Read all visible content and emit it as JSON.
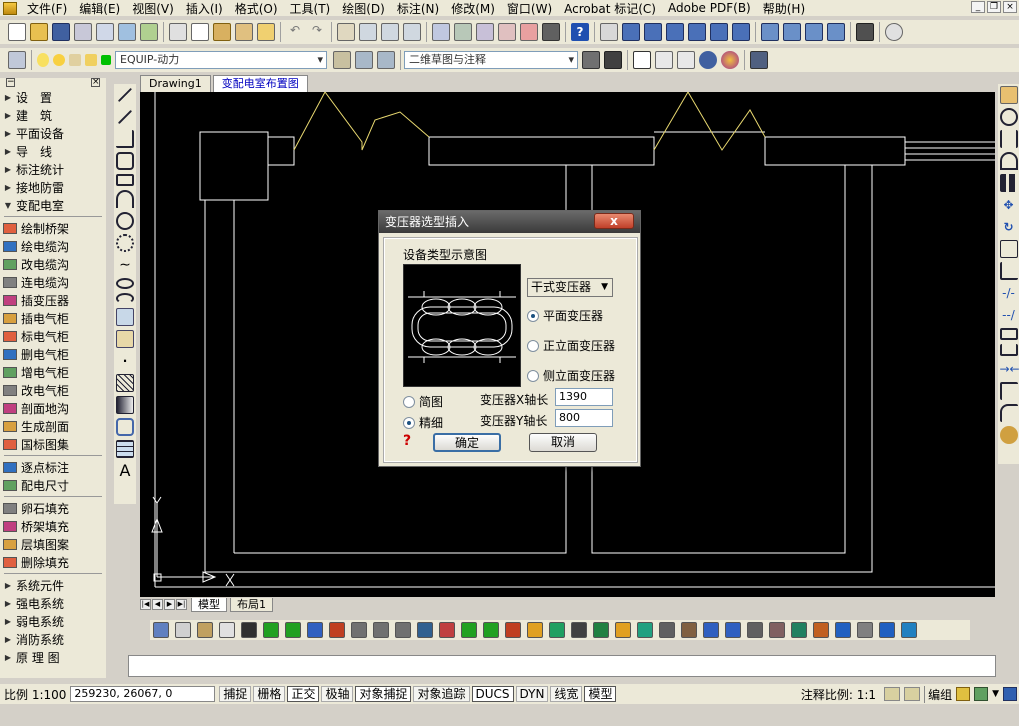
{
  "menu": {
    "items": [
      "文件(F)",
      "编辑(E)",
      "视图(V)",
      "插入(I)",
      "格式(O)",
      "工具(T)",
      "绘图(D)",
      "标注(N)",
      "修改(M)",
      "窗口(W)",
      "Acrobat 标记(C)",
      "Adobe PDF(B)",
      "帮助(H)"
    ]
  },
  "toolbar": {
    "layer_combo": "EQUIP-动力",
    "workspace_combo": "二维草图与注释"
  },
  "sidebar": {
    "items": [
      {
        "label": "设　置",
        "type": "arrow"
      },
      {
        "label": "建　筑",
        "type": "arrow"
      },
      {
        "label": "平面设备",
        "type": "arrow"
      },
      {
        "label": "导　线",
        "type": "arrow"
      },
      {
        "label": "标注统计",
        "type": "arrow"
      },
      {
        "label": "接地防雷",
        "type": "arrow"
      },
      {
        "label": "变配电室",
        "type": "open"
      },
      {
        "label": "绘制桥架",
        "type": "icon"
      },
      {
        "label": "绘电缆沟",
        "type": "icon"
      },
      {
        "label": "改电缆沟",
        "type": "icon"
      },
      {
        "label": "连电缆沟",
        "type": "icon"
      },
      {
        "label": "插变压器",
        "type": "icon"
      },
      {
        "label": "插电气柜",
        "type": "icon"
      },
      {
        "label": "标电气柜",
        "type": "icon"
      },
      {
        "label": "删电气柜",
        "type": "icon"
      },
      {
        "label": "增电气柜",
        "type": "icon"
      },
      {
        "label": "改电气柜",
        "type": "icon"
      },
      {
        "label": "剖面地沟",
        "type": "icon"
      },
      {
        "label": "生成剖面",
        "type": "icon"
      },
      {
        "label": "国标图集",
        "type": "icon"
      },
      {
        "label": "逐点标注",
        "type": "icon"
      },
      {
        "label": "配电尺寸",
        "type": "icon"
      },
      {
        "label": "卵石填充",
        "type": "icon"
      },
      {
        "label": "桥架填充",
        "type": "icon"
      },
      {
        "label": "层填图案",
        "type": "icon"
      },
      {
        "label": "删除填充",
        "type": "icon"
      },
      {
        "label": "系统元件",
        "type": "arrow"
      },
      {
        "label": "强电系统",
        "type": "arrow"
      },
      {
        "label": "弱电系统",
        "type": "arrow"
      },
      {
        "label": "消防系统",
        "type": "arrow"
      },
      {
        "label": "原 理 图",
        "type": "arrow"
      }
    ]
  },
  "drawing_tabs": [
    "Drawing1",
    "变配电室布置图"
  ],
  "layout_tabs": [
    "模型",
    "布局1"
  ],
  "dialog": {
    "title": "变压器选型插入",
    "preview_label": "设备类型示意图",
    "type_select": "干式变压器",
    "view_options": [
      "平面变压器",
      "正立面变压器",
      "侧立面变压器"
    ],
    "detail_options": [
      "简图",
      "精细"
    ],
    "x_label": "变压器X轴长",
    "x_value": "1390",
    "y_label": "变压器Y轴长",
    "y_value": "800",
    "ok_label": "确定",
    "cancel_label": "取消",
    "help_glyph": "?",
    "close_glyph": "x"
  },
  "status": {
    "scale": "比例 1:100",
    "coords": "259230, 26067, 0",
    "toggles": [
      "捕捉",
      "栅格",
      "正交",
      "极轴",
      "对象捕捉",
      "对象追踪",
      "DUCS",
      "DYN",
      "线宽",
      "模型"
    ],
    "annotation_scale": "注释比例: 1:1",
    "right_label": "编组"
  },
  "colors": {
    "canvas_bg": "#000000",
    "line_white": "#ffffff",
    "line_yellow": "#e8d870",
    "dialog_title": "#4a4a4a"
  }
}
